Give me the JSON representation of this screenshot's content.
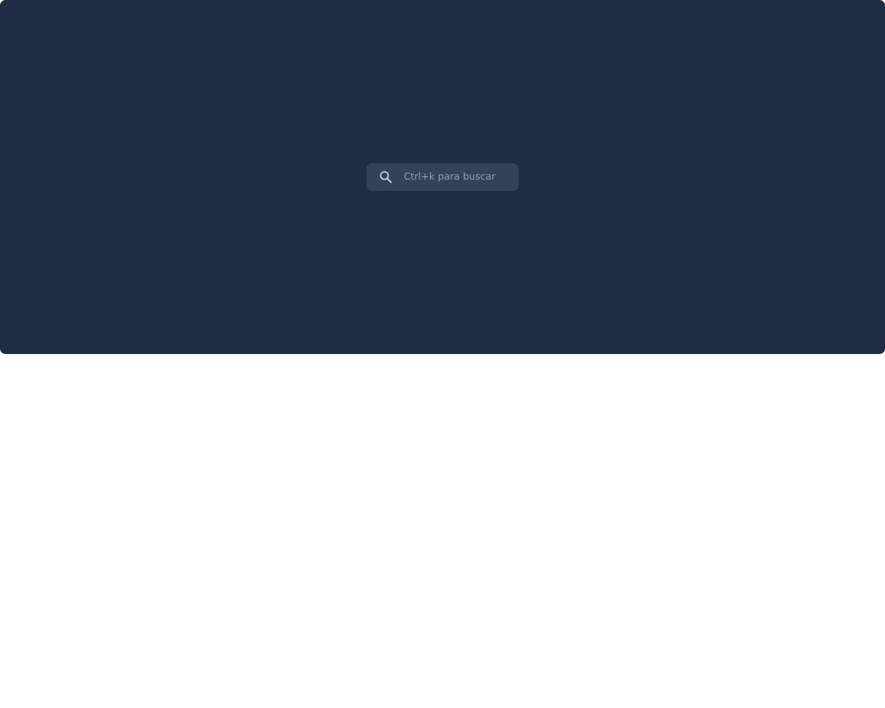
{
  "search": {
    "placeholder": "Ctrl+k para buscar",
    "icon": "search-icon"
  },
  "colors": {
    "panel_background": "#1e2d45",
    "search_background": "#334259",
    "search_icon": "#b4c8f0",
    "placeholder_text": "#8e9bb0",
    "page_background": "#ffffff"
  }
}
